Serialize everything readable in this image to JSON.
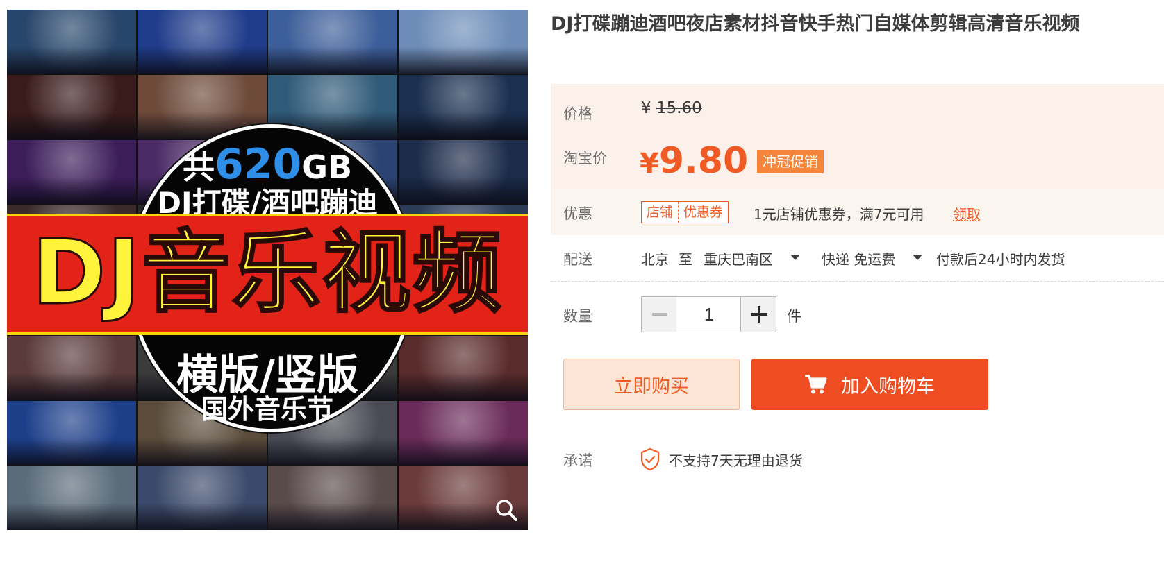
{
  "product": {
    "title": "DJ打碟蹦迪酒吧夜店素材抖音快手热门自媒体剪辑高清音乐视频"
  },
  "image": {
    "line1_prefix": "共",
    "line1_number": "620",
    "line1_suffix": "GB",
    "line2": "DJ打碟/酒吧蹦迪",
    "banner": "DJ音乐视频",
    "line3": "横版/竖版",
    "line4": "国外音乐节",
    "tile_colors": [
      "#27466b",
      "#1f3c8a",
      "#3c5e99",
      "#6d8db8",
      "#3a1b1b",
      "#6d4a3a",
      "#2f5a78",
      "#1b3050",
      "#3c1d5a",
      "#4b2a66",
      "#2b4373",
      "#1c2b4a",
      "#3a2a2a",
      "#2b2b2b",
      "#2b2b2b",
      "#2b3b58",
      "#2b2b2b",
      "#3b3b3b",
      "#3b3b3b",
      "#4c3a2a",
      "#5a3a3a",
      "#3b3b3b",
      "#3b3b3b",
      "#5a2b2b",
      "#1d3f8a",
      "#5a4b3a",
      "#4a4a55",
      "#6a2b5a",
      "#5a6b7a",
      "#3b4a6b",
      "#5a4b4b",
      "#6b3b3b"
    ]
  },
  "price_section": {
    "price_label": "价格",
    "currency": "¥",
    "original_price": "15.60",
    "taobao_label": "淘宝价",
    "sale_currency": "¥",
    "sale_price": "9.80",
    "promo_badge": "冲冠促销",
    "sale_color": "#f05a24"
  },
  "promotion": {
    "label": "优惠",
    "tag_left": "店铺",
    "tag_right": "优惠券",
    "text": "1元店铺优惠券，满7元可用",
    "claim": "领取"
  },
  "delivery": {
    "label": "配送",
    "from": "北京",
    "to_word": "至",
    "destination": "重庆巴南区",
    "method": "快递 免运费",
    "dispatch": "付款后24小时内发货"
  },
  "quantity": {
    "label": "数量",
    "value": "1",
    "unit": "件"
  },
  "actions": {
    "buy_now": "立即购买",
    "add_to_cart": "加入购物车"
  },
  "pledge": {
    "label": "承诺",
    "text": "不支持7天无理由退货"
  }
}
